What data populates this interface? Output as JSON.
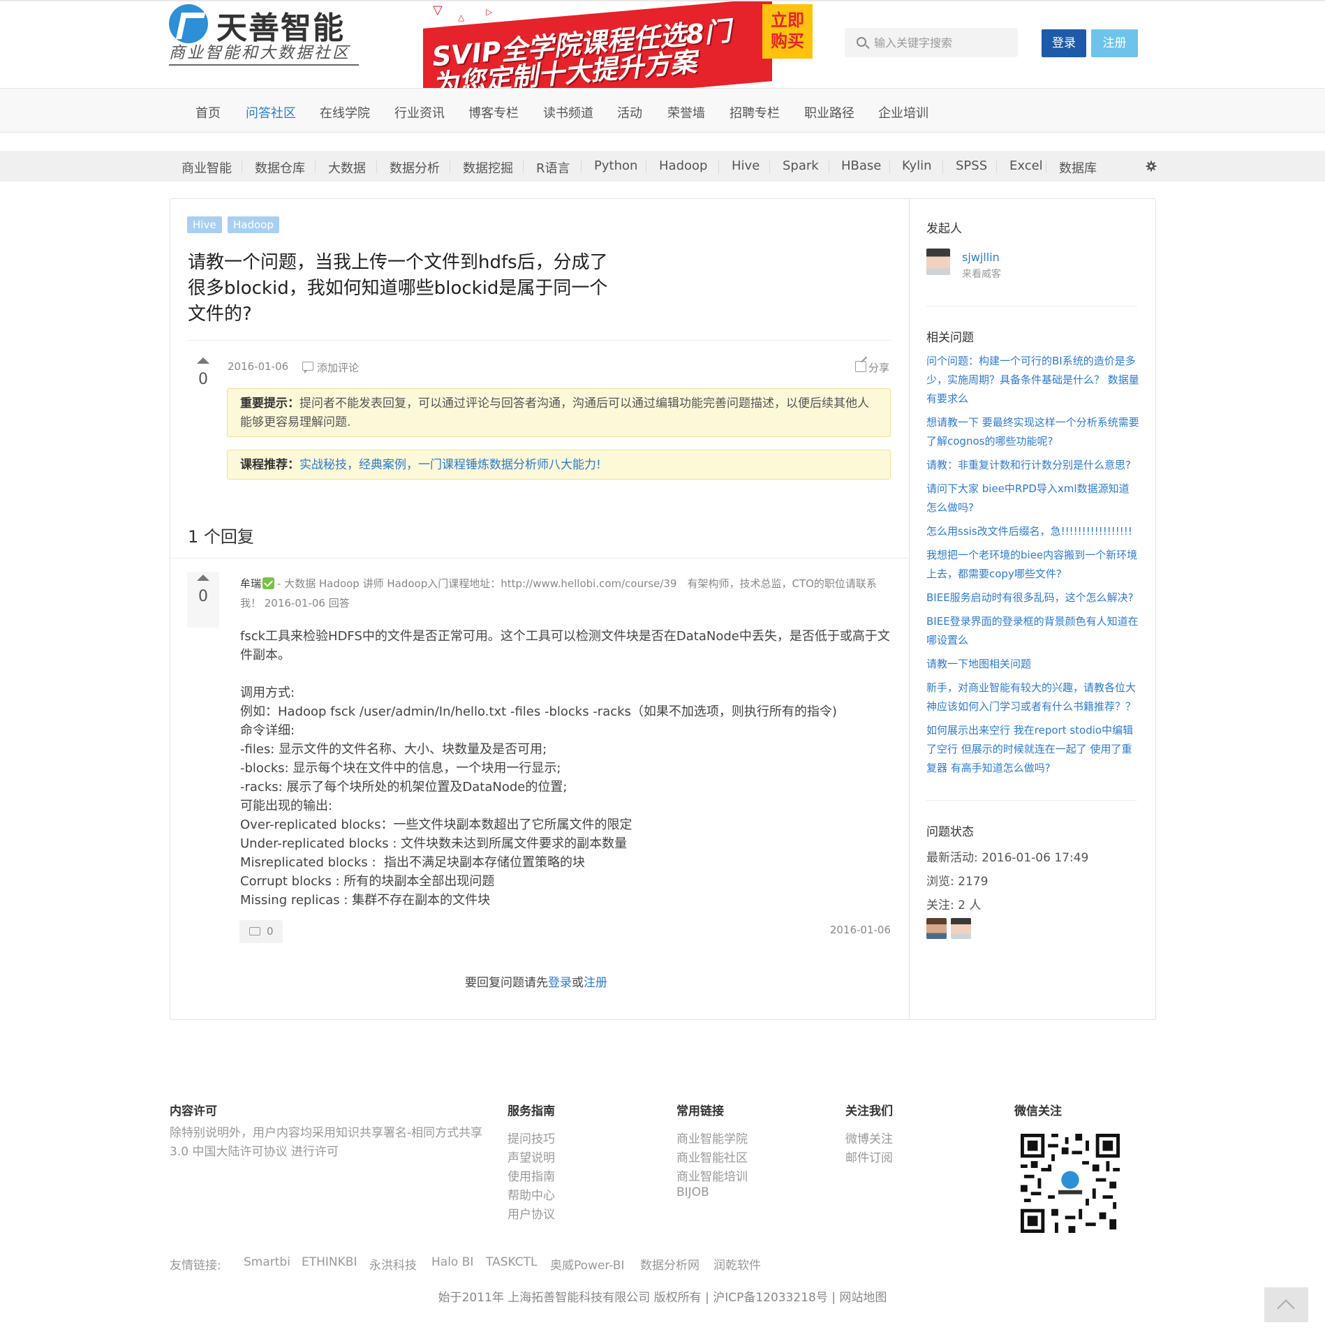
{
  "header": {
    "logo_name": "天善智能",
    "logo_slogan": "商业智能和大数据社区",
    "banner": {
      "line1": "SVIP全学院课程任选8门",
      "line2": "为您定制十大提升方案",
      "cta_line1": "立即",
      "cta_line2": "购买"
    },
    "search_placeholder": "输入关键字搜索",
    "login_label": "登录",
    "register_label": "注册"
  },
  "main_nav": {
    "items": [
      {
        "label": "首页"
      },
      {
        "label": "问答社区",
        "active": true
      },
      {
        "label": "在线学院"
      },
      {
        "label": "行业资讯"
      },
      {
        "label": "博客专栏"
      },
      {
        "label": "读书频道"
      },
      {
        "label": "活动"
      },
      {
        "label": "荣誉墙"
      },
      {
        "label": "招聘专栏"
      },
      {
        "label": "职业路径"
      },
      {
        "label": "企业培训"
      }
    ]
  },
  "tag_nav": {
    "items": [
      "商业智能",
      "数据仓库",
      "大数据",
      "数据分析",
      "数据挖掘",
      "R语言",
      "Python",
      "Hadoop",
      "Hive",
      "Spark",
      "HBase",
      "Kylin",
      "SPSS",
      "Excel",
      "数据库"
    ]
  },
  "question": {
    "tags": [
      "Hive",
      "Hadoop"
    ],
    "title": "请教一个问题，当我上传一个文件到hdfs后，分成了很多blockid，我如何知道哪些blockid是属于同一个文件的?",
    "votes": "0",
    "date": "2016-01-06",
    "add_comment": "添加评论",
    "share": "分享",
    "notice_label": "重要提示：",
    "notice_text": "提问者不能发表回复，可以通过评论与回答者沟通，沟通后可以通过编辑功能完善问题描述，以便后续其他人能够更容易理解问题.",
    "course_label": "课程推荐：",
    "course_text": "实战秘技，经典案例，一门课程锤炼数据分析师八大能力!"
  },
  "replies": {
    "count_label": "1 个回复"
  },
  "answer": {
    "votes": "0",
    "user": "牟瑞",
    "meta": "- 大数据 Hadoop 讲师 Hadoop入门课程地址：http://www.hellobi.com/course/39　有架构师，技术总监，CTO的职位请联系我！ 2016-01-06 回答",
    "body_p1": "fsck工具来检验HDFS中的文件是否正常可用。这个工具可以检测文件块是否在DataNode中丢失，是否低于或高于文件副本。",
    "body_lines": [
      "调用方式:",
      "例如：Hadoop fsck /user/admin/In/hello.txt -files -blocks -racks（如果不加选项，则执行所有的指令)",
      "命令详细:",
      "-files: 显示文件的文件名称、大小、块数量及是否可用;",
      "-blocks: 显示每个块在文件中的信息，一个块用一行显示;",
      "-racks: 展示了每个块所处的机架位置及DataNode的位置;",
      "可能出现的输出:",
      "Over-replicated blocks：一些文件块副本数超出了它所属文件的限定",
      "Under-replicated blocks : 文件块数未达到所属文件要求的副本数量",
      "Misreplicated blocks :  指出不满足块副本存储位置策略的块",
      "Corrupt blocks : 所有的块副本全部出现问题",
      "Missing replicas : 集群不存在副本的文件块"
    ],
    "comment_count": "0",
    "date": "2016-01-06"
  },
  "reply_hint": {
    "prefix": "要回复问题请先",
    "login": "登录",
    "or": "或",
    "register": "注册"
  },
  "sidebar": {
    "asker_heading": "发起人",
    "asker_name": "sjwjllin",
    "asker_sub": "来看威客",
    "related_heading": "相关问题",
    "related": [
      "问个问题：构建一个可行的BI系统的造价是多少，实施周期？具备条件基础是什么？ 数据量有要求么",
      "想请教一下 要最终实现这样一个分析系统需要了解cognos的哪些功能呢?",
      "请教：非重复计数和行计数分别是什么意思?",
      "请问下大家 biee中RPD导入xml数据源知道怎么做吗?",
      "怎么用ssis改文件后缀名，急!!!!!!!!!!!!!!!!!",
      "我想把一个老环境的biee内容搬到一个新环境上去，都需要copy哪些文件?",
      "BIEE服务启动时有很多乱码，这个怎么解决?",
      "BIEE登录界面的登录框的背景颜色有人知道在哪设置么",
      "请教一下地图相关问题",
      "新手，对商业智能有较大的兴趣，请教各位大神应该如何入门学习或者有什么书籍推荐？？",
      "如何展示出来空行 我在report stodio中编辑了空行 但展示的时候就连在一起了 使用了重复器 有高手知道怎么做吗?"
    ],
    "status_heading": "问题状态",
    "last_active": "最新活动: 2016-01-06 17:49",
    "views": "浏览: 2179",
    "followers": "关注: 2 人"
  },
  "footer": {
    "license_heading": "内容许可",
    "license_text": "除特别说明外，用户内容均采用知识共享署名-相同方式共享 3.0 中国大陆许可协议 进行许可",
    "service_heading": "服务指南",
    "service_links": [
      "提问技巧",
      "声望说明",
      "使用指南",
      "帮助中心",
      "用户协议"
    ],
    "common_heading": "常用链接",
    "common_links": [
      "商业智能学院",
      "商业智能社区",
      "商业智能培训",
      "BIJOB"
    ],
    "follow_heading": "关注我们",
    "follow_links": [
      "微博关注",
      "邮件订阅"
    ],
    "wechat_heading": "微信关注",
    "friends_label": "友情链接:",
    "friends": [
      "Smartbi",
      "ETHINKBI",
      "永洪科技",
      "Halo BI",
      "TASKCTL",
      "奥威Power-BI",
      "数据分析网",
      "润乾软件"
    ],
    "copyright": "始于2011年 上海拓善智能科技有限公司 版权所有 | 沪ICP备12033218号 | 网站地图"
  },
  "colors": {
    "link": "#2d7bd2",
    "login_btn": "#1f5aa9",
    "register_btn": "#6ec3ea",
    "tag_bg": "#a8cff2",
    "notice_bg": "#fcf8d8",
    "banner_red": "#e6222a",
    "banner_yellow": "#ffc20e"
  }
}
